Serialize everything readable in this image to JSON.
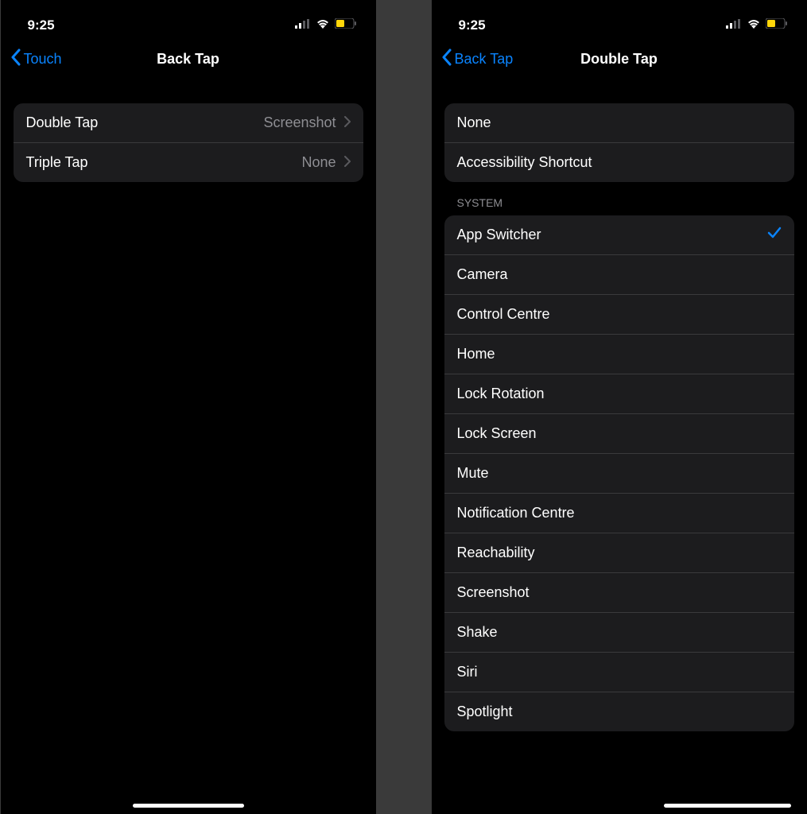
{
  "status": {
    "time": "9:25"
  },
  "left": {
    "back_label": "Touch",
    "title": "Back Tap",
    "cells": [
      {
        "label": "Double Tap",
        "value": "Screenshot"
      },
      {
        "label": "Triple Tap",
        "value": "None"
      }
    ]
  },
  "right": {
    "back_label": "Back Tap",
    "title": "Double Tap",
    "top_cells": [
      {
        "label": "None"
      },
      {
        "label": "Accessibility Shortcut"
      }
    ],
    "section_header": "SYSTEM",
    "system_cells": [
      {
        "label": "App Switcher",
        "selected": true
      },
      {
        "label": "Camera"
      },
      {
        "label": "Control Centre"
      },
      {
        "label": "Home"
      },
      {
        "label": "Lock Rotation"
      },
      {
        "label": "Lock Screen"
      },
      {
        "label": "Mute"
      },
      {
        "label": "Notification Centre"
      },
      {
        "label": "Reachability"
      },
      {
        "label": "Screenshot"
      },
      {
        "label": "Shake"
      },
      {
        "label": "Siri"
      },
      {
        "label": "Spotlight"
      }
    ]
  }
}
